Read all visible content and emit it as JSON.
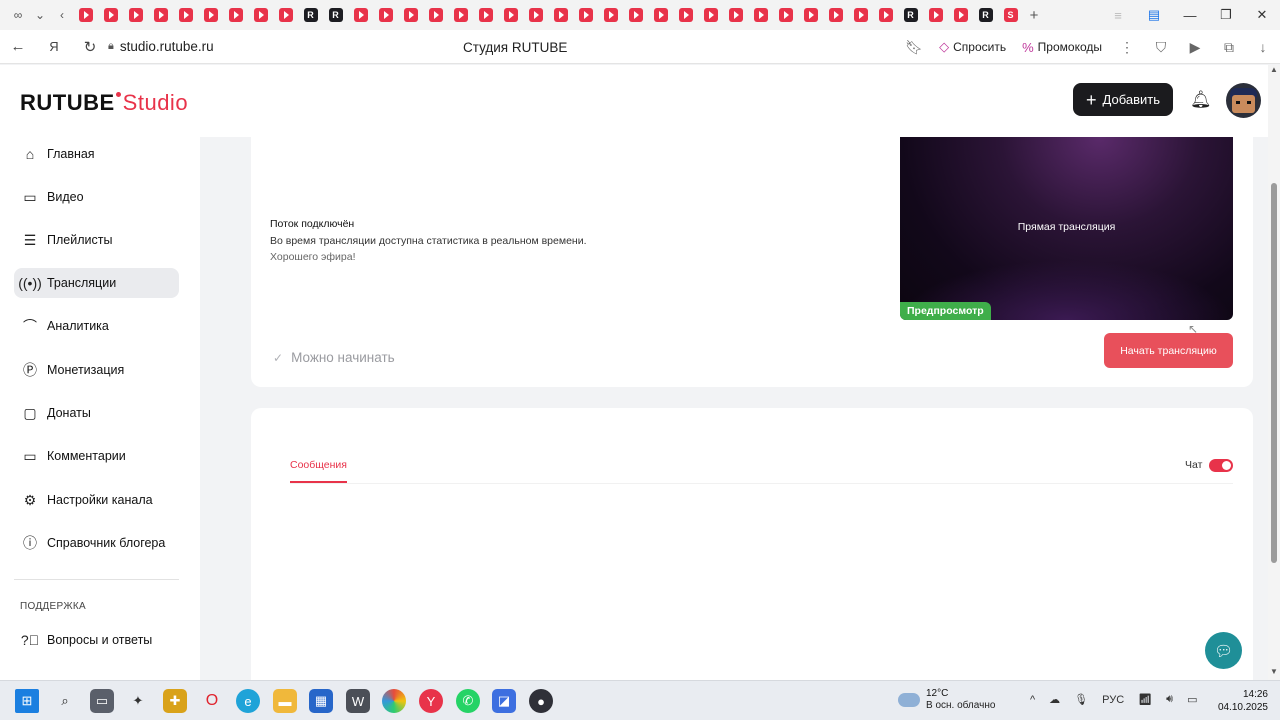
{
  "browser": {
    "url": "studio.rutube.ru",
    "page_title": "Студия RUTUBE",
    "ask_label": "Спросить",
    "promo_label": "Промокоды"
  },
  "header": {
    "logo_main": "RUTUBE",
    "logo_studio": "Studio",
    "add_label": "Добавить"
  },
  "sidebar": {
    "items": [
      {
        "label": "Главная",
        "icon": "home-icon"
      },
      {
        "label": "Видео",
        "icon": "video-icon"
      },
      {
        "label": "Плейлисты",
        "icon": "playlist-icon"
      },
      {
        "label": "Трансляции",
        "icon": "broadcast-icon",
        "active": true
      },
      {
        "label": "Аналитика",
        "icon": "analytics-icon"
      },
      {
        "label": "Монетизация",
        "icon": "monetization-icon"
      },
      {
        "label": "Донаты",
        "icon": "donations-icon"
      },
      {
        "label": "Комментарии",
        "icon": "comments-icon"
      },
      {
        "label": "Настройки канала",
        "icon": "gear-icon"
      },
      {
        "label": "Справочник блогера",
        "icon": "info-icon"
      }
    ],
    "support_label": "ПОДДЕРЖКА",
    "support_items": [
      {
        "label": "Вопросы и ответы",
        "icon": "help-icon"
      }
    ]
  },
  "stream": {
    "title": "Поток подключён",
    "desc_line1": "Во время трансляции доступна статистика в реальном времени.",
    "desc_line2": "Хорошего эфира!",
    "preview_label": "Прямая трансляция",
    "preview_badge": "Предпросмотр",
    "ready_label": "Можно начинать",
    "start_label": "Начать трансляцию"
  },
  "chat": {
    "tab_messages": "Сообщения",
    "chat_label": "Чат",
    "chat_enabled": true
  },
  "taskbar": {
    "temperature": "12°C",
    "weather": "В осн. облачно",
    "language": "РУС",
    "time": "14:26",
    "date": "04.10.2025"
  },
  "colors": {
    "accent": "#e8334a",
    "start_button": "#e8505b",
    "preview_badge": "#3fae4a",
    "help_fab": "#1f8f98"
  }
}
